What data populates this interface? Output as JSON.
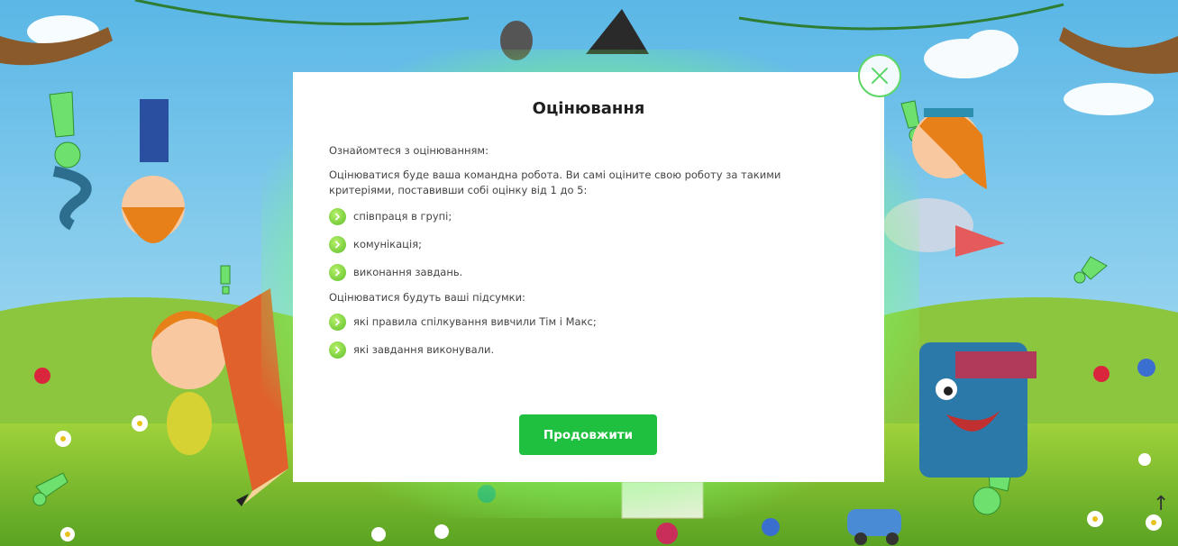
{
  "modal": {
    "title": "Оцінювання",
    "intro": "Ознайомтеся з оцінюванням:",
    "teamwork_text": "Оцінюватися буде ваша командна робота. Ви самі оціните свою роботу за такими критеріями, поставивши собі оцінку від 1 до 5:",
    "criteria": [
      {
        "label": "співпраця в групі;"
      },
      {
        "label": "комунікація;"
      },
      {
        "label": "виконання завдань."
      }
    ],
    "results_text": "Оцінюватися будуть ваші підсумки:",
    "results": [
      {
        "label": "які правила спілкування вивчили Тім і Макс;"
      },
      {
        "label": "які завдання виконували."
      }
    ],
    "continue_label": "Продовжити"
  },
  "icons": {
    "close": "close-icon",
    "bullet": "chevron-right-icon",
    "scroll": "arrow-up-icon"
  },
  "colors": {
    "accent": "#1fbf3f",
    "glow": "#78ff6e",
    "bullet": "#7fd63a"
  }
}
